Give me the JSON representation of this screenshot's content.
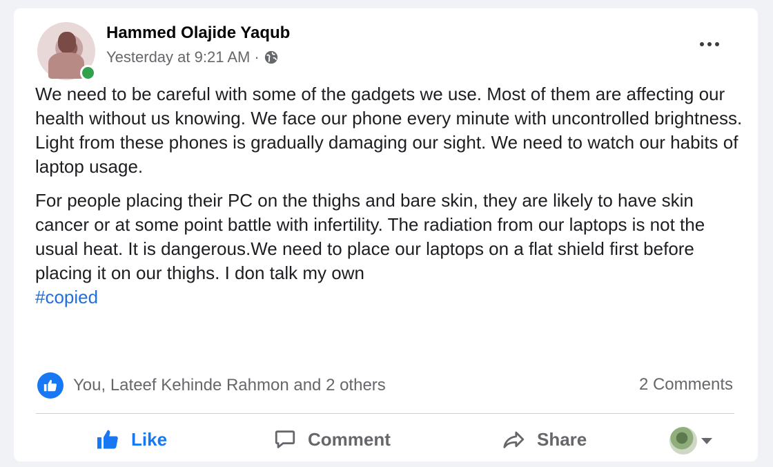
{
  "post": {
    "author": "Hammed Olajide Yaqub",
    "timestamp": "Yesterday at 9:21 AM",
    "separator": "·",
    "privacy_icon": "globe-icon",
    "more_icon": "more-options-icon",
    "paragraphs": [
      "We need to be careful with some of the gadgets we use. Most of them are affecting our health without us knowing. We face our phone every minute with uncontrolled brightness. Light from these phones is gradually damaging our sight. We need to watch our habits of laptop usage.",
      "For people placing their PC on the thighs and bare skin, they are likely to have skin cancer or at some point battle with infertility. The radiation from our laptops is not the usual heat. It is dangerous.We need to place our laptops on a flat shield first before placing it on our thighs. I don talk my own"
    ],
    "hashtag": "#copied"
  },
  "reactions": {
    "icon": "like-reaction-icon",
    "summary": "You, Lateef Kehinde Rahmon and 2 others",
    "comments": "2 Comments"
  },
  "actions": {
    "like_label": "Like",
    "comment_label": "Comment",
    "share_label": "Share"
  },
  "colors": {
    "accent": "#1877f2",
    "secondary_text": "#65676b",
    "online": "#31a24c"
  }
}
